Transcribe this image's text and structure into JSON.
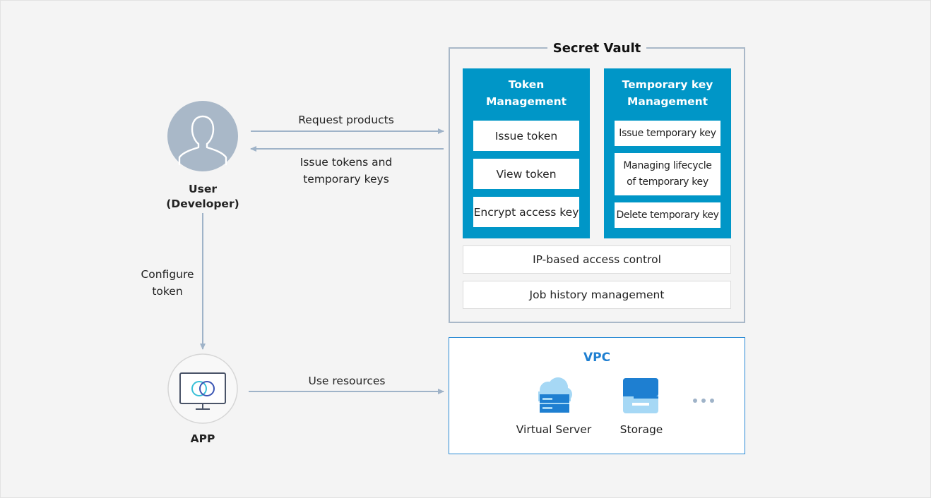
{
  "vault": {
    "title": "Secret Vault",
    "token_panel": {
      "title_line1": "Token",
      "title_line2": "Management",
      "items": [
        "Issue token",
        "View token",
        "Encrypt access key"
      ]
    },
    "tempkey_panel": {
      "title_line1": "Temporary key",
      "title_line2": "Management",
      "items": [
        "Issue temporary key",
        "Managing lifecycle",
        "of temporary key",
        "Delete temporary key"
      ]
    },
    "ip_control": "IP-based access control",
    "job_history": "Job history management"
  },
  "user": {
    "line1": "User",
    "line2": "(Developer)"
  },
  "app": {
    "label": "APP"
  },
  "flows": {
    "request": "Request products",
    "issue_line1": "Issue tokens and",
    "issue_line2": "temporary keys",
    "configure_line1": "Configure",
    "configure_line2": "token",
    "use_resources": "Use resources"
  },
  "vpc": {
    "title": "VPC",
    "virtual_server": "Virtual Server",
    "storage": "Storage"
  },
  "colors": {
    "panel_blue": "#0096c7",
    "vpc_blue": "#1e7fd1",
    "arrow": "#9fb3c8",
    "vault_border": "#a9b8c8"
  }
}
